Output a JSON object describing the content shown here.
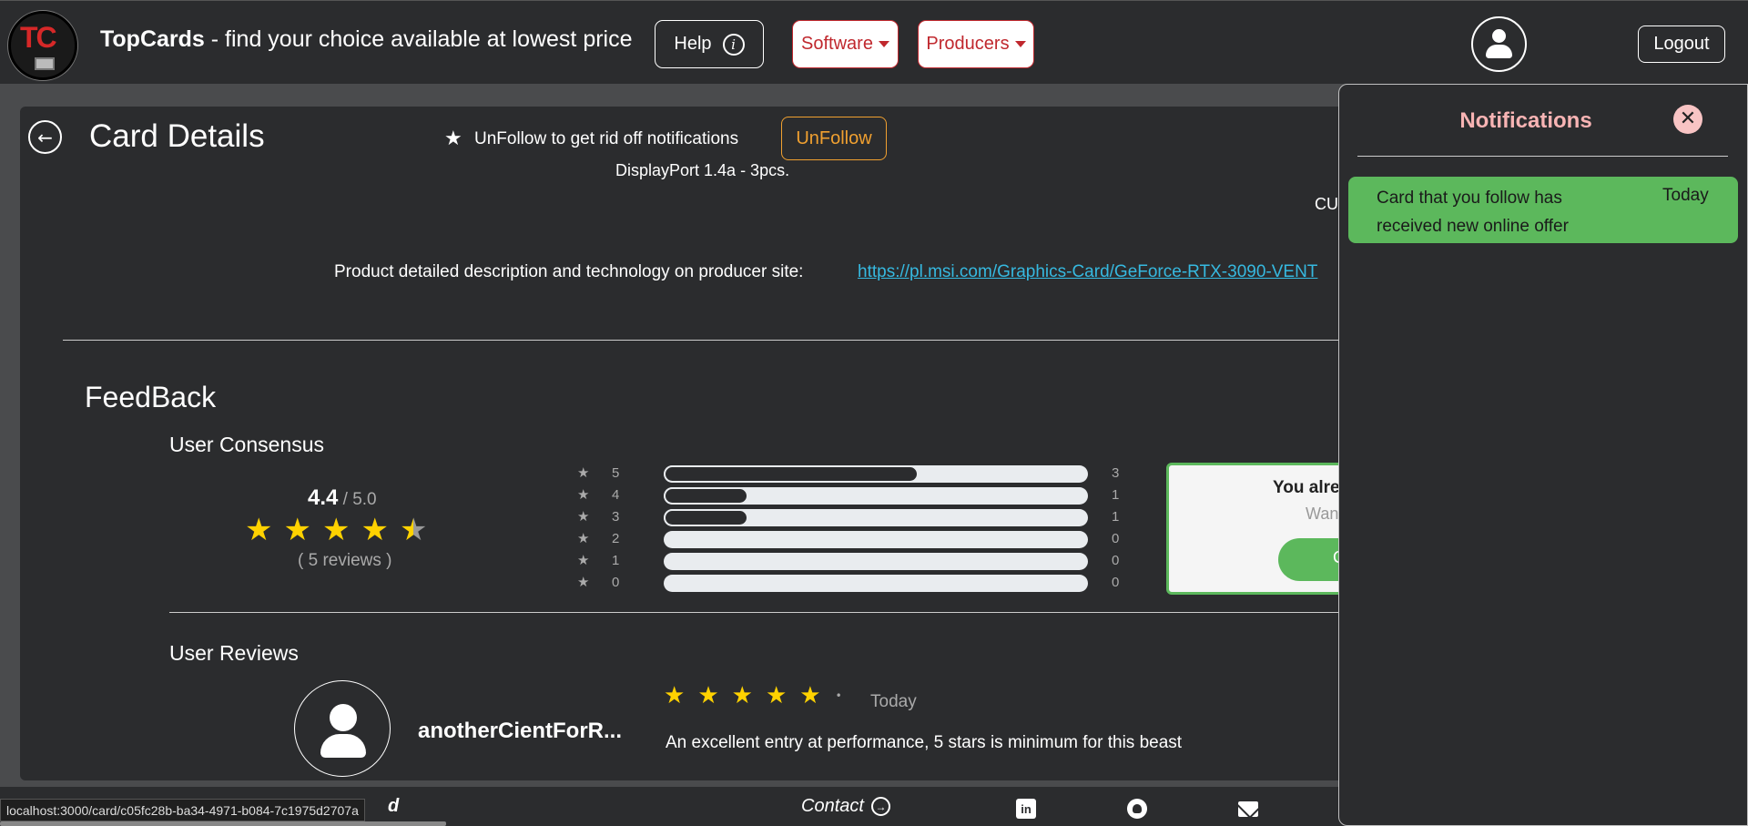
{
  "navbar": {
    "logo_text": "TC",
    "brand_name": "TopCards",
    "brand_tagline": " - find your choice available at lowest price",
    "help_label": "Help",
    "software_label": "Software",
    "producers_label": "Producers",
    "logout_label": "Logout"
  },
  "card": {
    "title": "Card Details",
    "unfollow_text": "UnFollow to get rid off notifications",
    "unfollow_button": "UnFollow",
    "port_text": "DisplayPort 1.4a - 3pcs.",
    "cut_text": "CU",
    "description_label": "Product detailed description and technology on producer site:",
    "description_link": "https://pl.msi.com/Graphics-Card/GeForce-RTX-3090-VENT"
  },
  "feedback": {
    "title": "FeedBack",
    "consensus_title": "User Consensus",
    "score": "4.4",
    "score_max": " / 5.0",
    "stars": [
      1,
      1,
      1,
      1,
      0.5
    ],
    "review_count": "( 5 reviews )",
    "histogram": [
      {
        "star": "5",
        "count": "3",
        "fraction": 0.6
      },
      {
        "star": "4",
        "count": "1",
        "fraction": 0.2
      },
      {
        "star": "3",
        "count": "1",
        "fraction": 0.2
      },
      {
        "star": "2",
        "count": "0",
        "fraction": 0
      },
      {
        "star": "1",
        "count": "0",
        "fraction": 0
      },
      {
        "star": "0",
        "count": "0",
        "fraction": 0
      }
    ],
    "already_title": "You alre",
    "already_sub": "Wan",
    "already_button": "C"
  },
  "reviews": {
    "title": "User Reviews",
    "items": [
      {
        "name": "anotherCientForR...",
        "rating": 5,
        "date": "Today",
        "text": "An excellent entry at performance, 5 stars is minimum for this beast"
      }
    ]
  },
  "footer": {
    "bold_text": "d",
    "contact_label": "Contact",
    "linkedin_glyph": "in"
  },
  "status_url": "localhost:3000/card/c05fc28b-ba34-4971-b084-7c1975d2707a",
  "notifications": {
    "title": "Notifications",
    "items": [
      {
        "message": "Card that you follow has received new online offer",
        "when": "Today",
        "color": "#5cb85c"
      }
    ]
  },
  "colors": {
    "background": "#4a4b4d",
    "panel": "#2b2c2e",
    "accent_red": "#c0282e",
    "accent_orange": "#f0a030",
    "star_yellow": "#ffd200",
    "success_green": "#5cb85c",
    "link_blue": "#36b9e0"
  }
}
